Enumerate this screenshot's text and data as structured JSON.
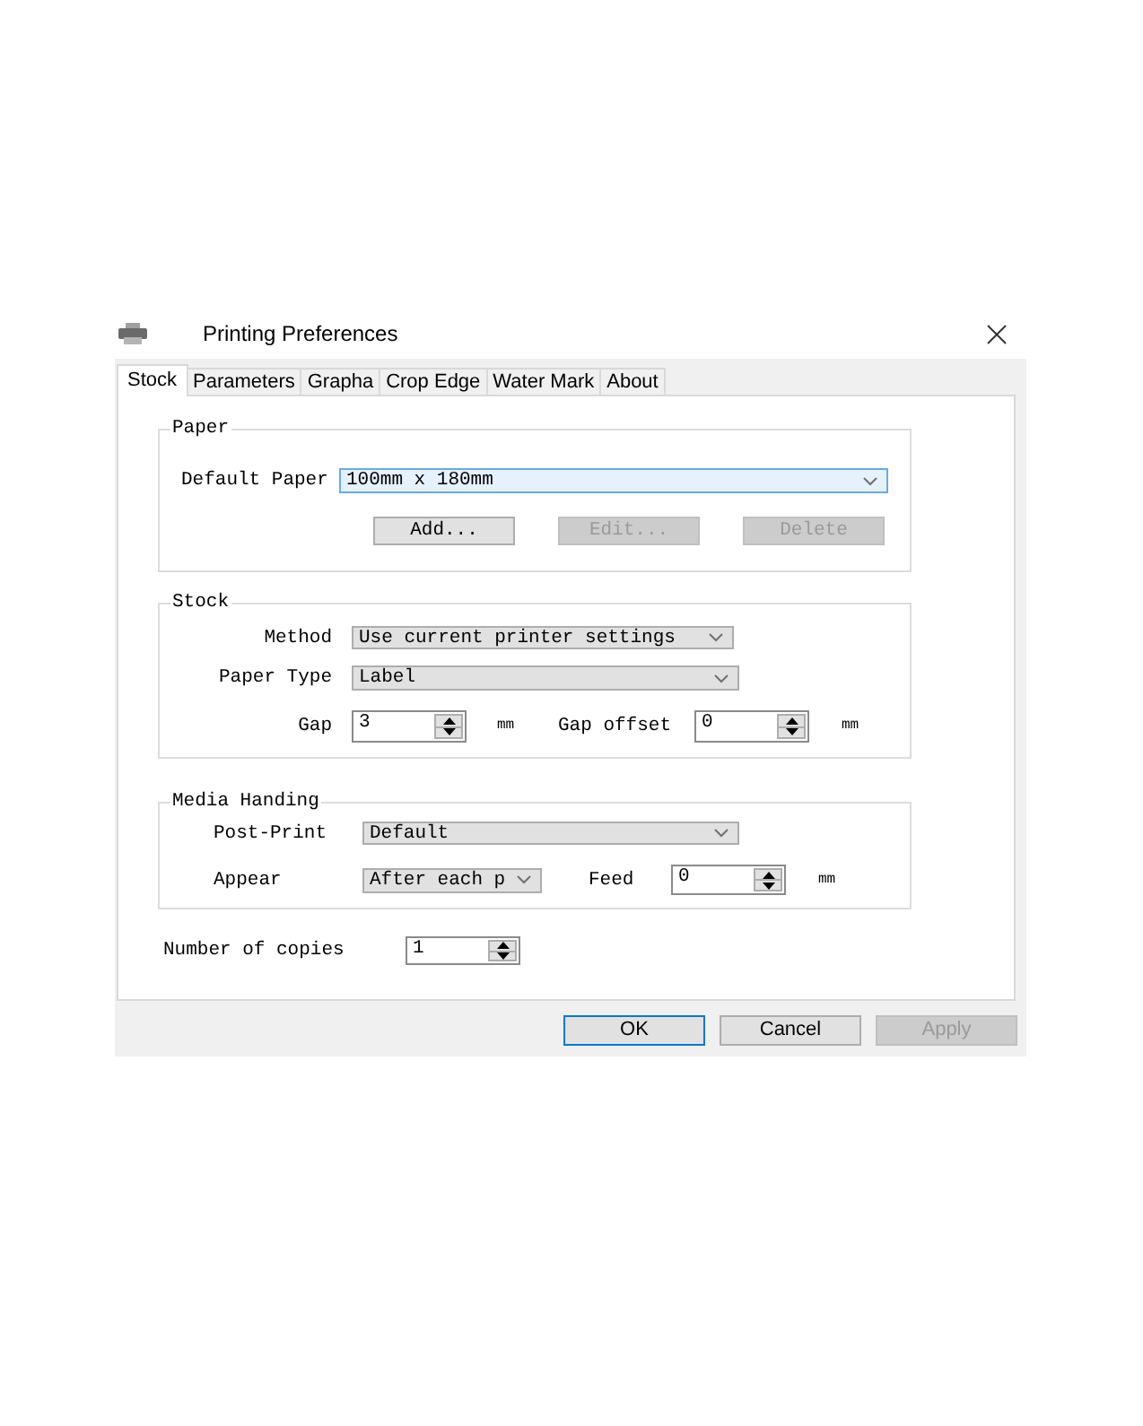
{
  "window": {
    "title": "Printing Preferences"
  },
  "tabs": [
    {
      "label": "Stock",
      "selected": true
    },
    {
      "label": "Parameters",
      "selected": false
    },
    {
      "label": "Grapha",
      "selected": false
    },
    {
      "label": "Crop Edge",
      "selected": false
    },
    {
      "label": "Water Mark",
      "selected": false
    },
    {
      "label": "About",
      "selected": false
    }
  ],
  "paper": {
    "title": "Paper",
    "default_paper": {
      "label": "Default Paper",
      "value": "100mm x 180mm",
      "focused": true
    },
    "buttons": [
      {
        "label": "Add...",
        "disabled": false
      },
      {
        "label": "Edit...",
        "disabled": true
      },
      {
        "label": "Delete",
        "disabled": true
      }
    ]
  },
  "stock": {
    "title": "Stock",
    "method": {
      "label": "Method",
      "value": "Use current printer settings",
      "focused": false
    },
    "paper_type": {
      "label": "Paper Type",
      "value": "Label",
      "focused": false
    },
    "gap": {
      "label": "Gap",
      "value": "3",
      "unit": "mm"
    },
    "gap_offset": {
      "label": "Gap offset",
      "value": "0",
      "unit": "mm"
    }
  },
  "media_handling": {
    "title": "Media Handing",
    "post_print": {
      "label": "Post-Print",
      "value": "Default",
      "focused": false
    },
    "appear": {
      "label": "Appear",
      "value": "After each p",
      "focused": false
    },
    "feed": {
      "label": "Feed",
      "value": "0",
      "unit": "mm"
    }
  },
  "copies": {
    "label": "Number of copies",
    "value": "1"
  },
  "buttons": [
    {
      "label": "OK",
      "default": true,
      "disabled": false
    },
    {
      "label": "Cancel",
      "default": false,
      "disabled": false
    },
    {
      "label": "Apply",
      "default": false,
      "disabled": true
    }
  ]
}
